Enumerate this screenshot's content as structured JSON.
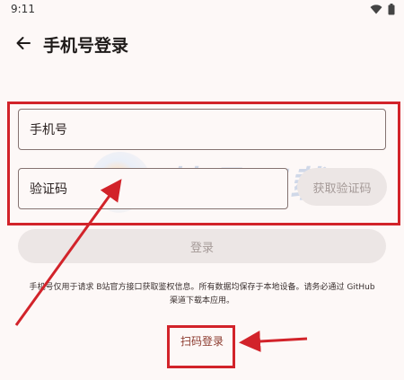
{
  "status_bar": {
    "time": "9:11",
    "icons": [
      "wifi-icon",
      "battery-icon"
    ]
  },
  "app_bar": {
    "title": "手机号登录",
    "back_icon": "arrow-left-icon"
  },
  "form": {
    "phone_label": "手机号",
    "code_label": "验证码",
    "get_code_label": "获取验证码",
    "login_label": "登录"
  },
  "disclaimer": "手机号仅用于请求 B站官方接口获取鉴权信息。所有数据均保存于本地设备。请务必通过 GitHub 渠道下载本应用。",
  "qr_login_label": "扫码登录",
  "watermark": {
    "text": "精品下载",
    "url": "www.jpxz.net"
  },
  "colors": {
    "annotation": "#d2232a",
    "background": "#fdf8f7",
    "disabled_button": "#ece6e5",
    "qr_link": "#8c3a2e"
  }
}
